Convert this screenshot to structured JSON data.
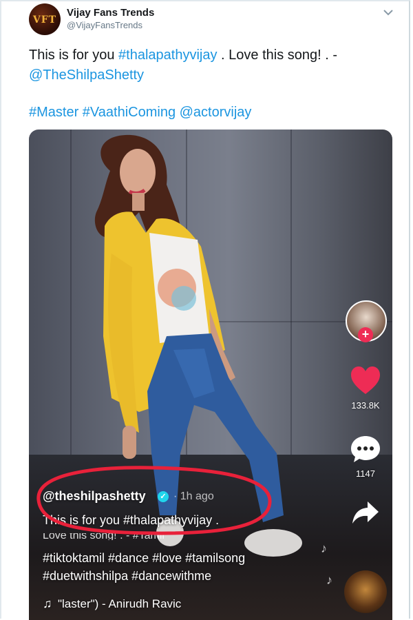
{
  "tweet": {
    "display_name": "Vijay Fans Trends",
    "handle": "@VijayFansTrends",
    "avatar_text": "VFT",
    "text_part1": "This is for you ",
    "text_link1": "#thalapathyvijay",
    "text_part2": " . Love this song! . -",
    "text_link2": "@TheShilpaShetty",
    "tags_line": "#Master #VaathiComing @actorvijay"
  },
  "video": {
    "username": "@theshilpashetty",
    "verified_mark": "✓",
    "time_ago": "· 1h ago",
    "caption": "This is for you #thalapathyvijay .",
    "caption_continued": "Love this song! . - #Tamil",
    "hashtags_line1": "#tiktoktamil #dance #love #tamilsong",
    "hashtags_line2": "#duetwithshilpa #dancewithme",
    "music_text": "\"laster\") - Anirudh Ravic",
    "likes": "133.8K",
    "comments": "1147",
    "follow_plus": "+"
  },
  "colors": {
    "link": "#1b95e0",
    "highlight_ring": "#e8213a",
    "heart": "#ee2c55"
  }
}
